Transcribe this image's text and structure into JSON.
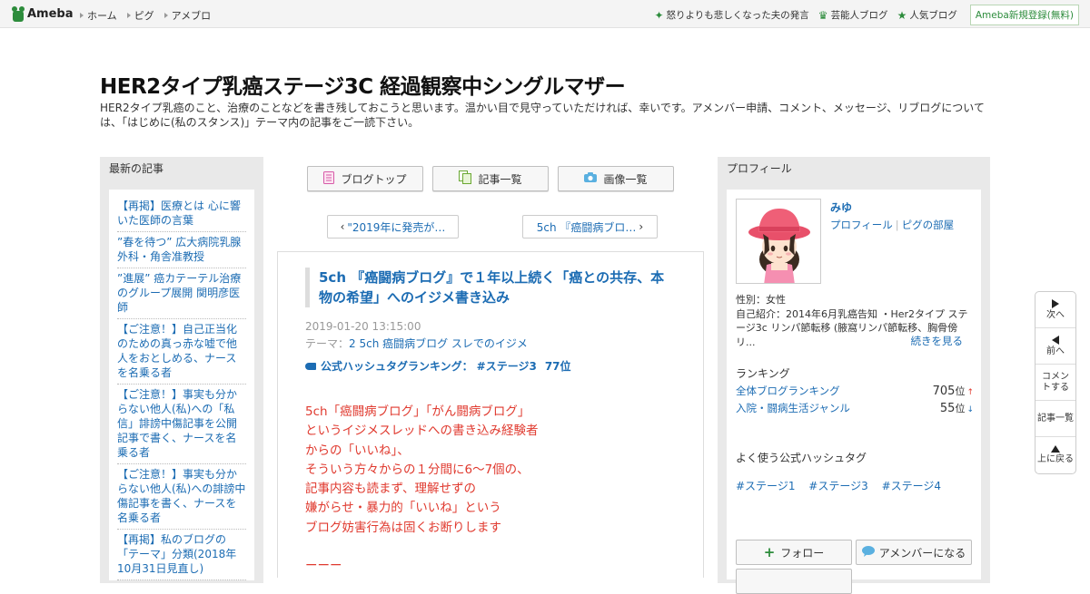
{
  "topbar": {
    "logo": "Ameba",
    "nav": [
      "ホーム",
      "ピグ",
      "アメブロ"
    ],
    "links": [
      {
        "icon": "sparkle-icon",
        "label": "怒りよりも悲しくなった夫の発言"
      },
      {
        "icon": "crown-icon",
        "label": "芸能人ブログ"
      },
      {
        "icon": "star-icon",
        "label": "人気ブログ"
      }
    ],
    "register": "Ameba新規登録(無料)"
  },
  "blog": {
    "title": "HER2タイプ乳癌ステージ3C 経過観察中シングルマザー",
    "description": "HER2タイプ乳癌のこと、治療のことなどを書き残しておこうと思います。温かい目で見守っていただければ、幸いです。アメンバー申請、コメント、メッセージ、リブログについては、「はじめに(私のスタンス)」テーマ内の記事をご一読下さい。"
  },
  "left_sidebar": {
    "heading": "最新の記事",
    "items": [
      "【再掲】医療とは 心に響いた医師の言葉",
      "”春を待つ” 広大病院乳腺外科・角舎准教授",
      "”進展” 癌カテーテル治療のグループ展開 関明彦医師",
      "【ご注意！】自己正当化のための真っ赤な嘘で他人をおとしめる、ナースを名乗る者",
      "【ご注意！】事実も分からない他人(私)への「私信」誹謗中傷記事を公開記事で書く、ナースを名乗る者",
      "【ご注意！】事実も分からない他人(私)への誹謗中傷記事を書く、ナースを名乗る者",
      "【再掲】私のブログの「テーマ」分類(2018年10月31日見直し)"
    ]
  },
  "tabs": {
    "top": "ブログトップ",
    "list": "記事一覧",
    "images": "画像一覧"
  },
  "pager": {
    "prev": "\"2019年に発売が…",
    "next": "5ch 『癌闘病ブロ…"
  },
  "article": {
    "title": "5ch 『癌闘病ブログ』で１年以上続く「癌との共存、本物の希望」へのイジメ書き込み",
    "date": "2019-01-20 13:15:00",
    "theme_label": "テーマ：",
    "theme": "2 5ch 癌闘病ブログ スレでのイジメ",
    "hashtag_label": "公式ハッシュタグランキング：",
    "hashtag": "#ステージ3",
    "hashtag_rank": "77位",
    "body_lines": [
      "5ch「癌闘病ブログ」「がん闘病ブログ」",
      "というイジメスレッドへの書き込み経験者",
      "からの「いいね」、",
      "そういう方々からの１分間に6～7個の、",
      "記事内容も読まず、理解せずの",
      "嫌がらせ・暴力的「いいね」という",
      "ブログ妨害行為は固くお断りします",
      "",
      "ーーー"
    ]
  },
  "profile": {
    "heading": "プロフィール",
    "name": "みゆ",
    "link_profile": "プロフィール",
    "link_room": "ピグの部屋",
    "gender": "性別：女性",
    "intro": "自己紹介：2014年6月乳癌告知 ・Her2タイプ ステージ3c リンパ節転移 (腋窩リンパ節転移、胸骨傍リ...",
    "more": "続きを見る",
    "ranking_heading": "ランキング",
    "rankings": [
      {
        "label": "全体ブログランキング",
        "value": "705",
        "unit": "位",
        "trend": "↑"
      },
      {
        "label": "入院・闘病生活ジャンル",
        "value": "55",
        "unit": "位",
        "trend": "↓"
      }
    ],
    "hashtags_heading": "よく使う公式ハッシュタグ",
    "hashtags": [
      "#ステージ1",
      "#ステージ3",
      "#ステージ4"
    ],
    "follow": "フォロー",
    "amember": "アメンバーになる"
  },
  "float_nav": {
    "next": "次へ",
    "prev": "前へ",
    "comment": "コメントする",
    "list": "記事一覧",
    "top": "上に戻る"
  },
  "colors": {
    "link": "#1c6cb3",
    "accent_green": "#2d8c3c",
    "body_red": "#e03a2f",
    "sidebar_bg": "#e9e9e9"
  }
}
